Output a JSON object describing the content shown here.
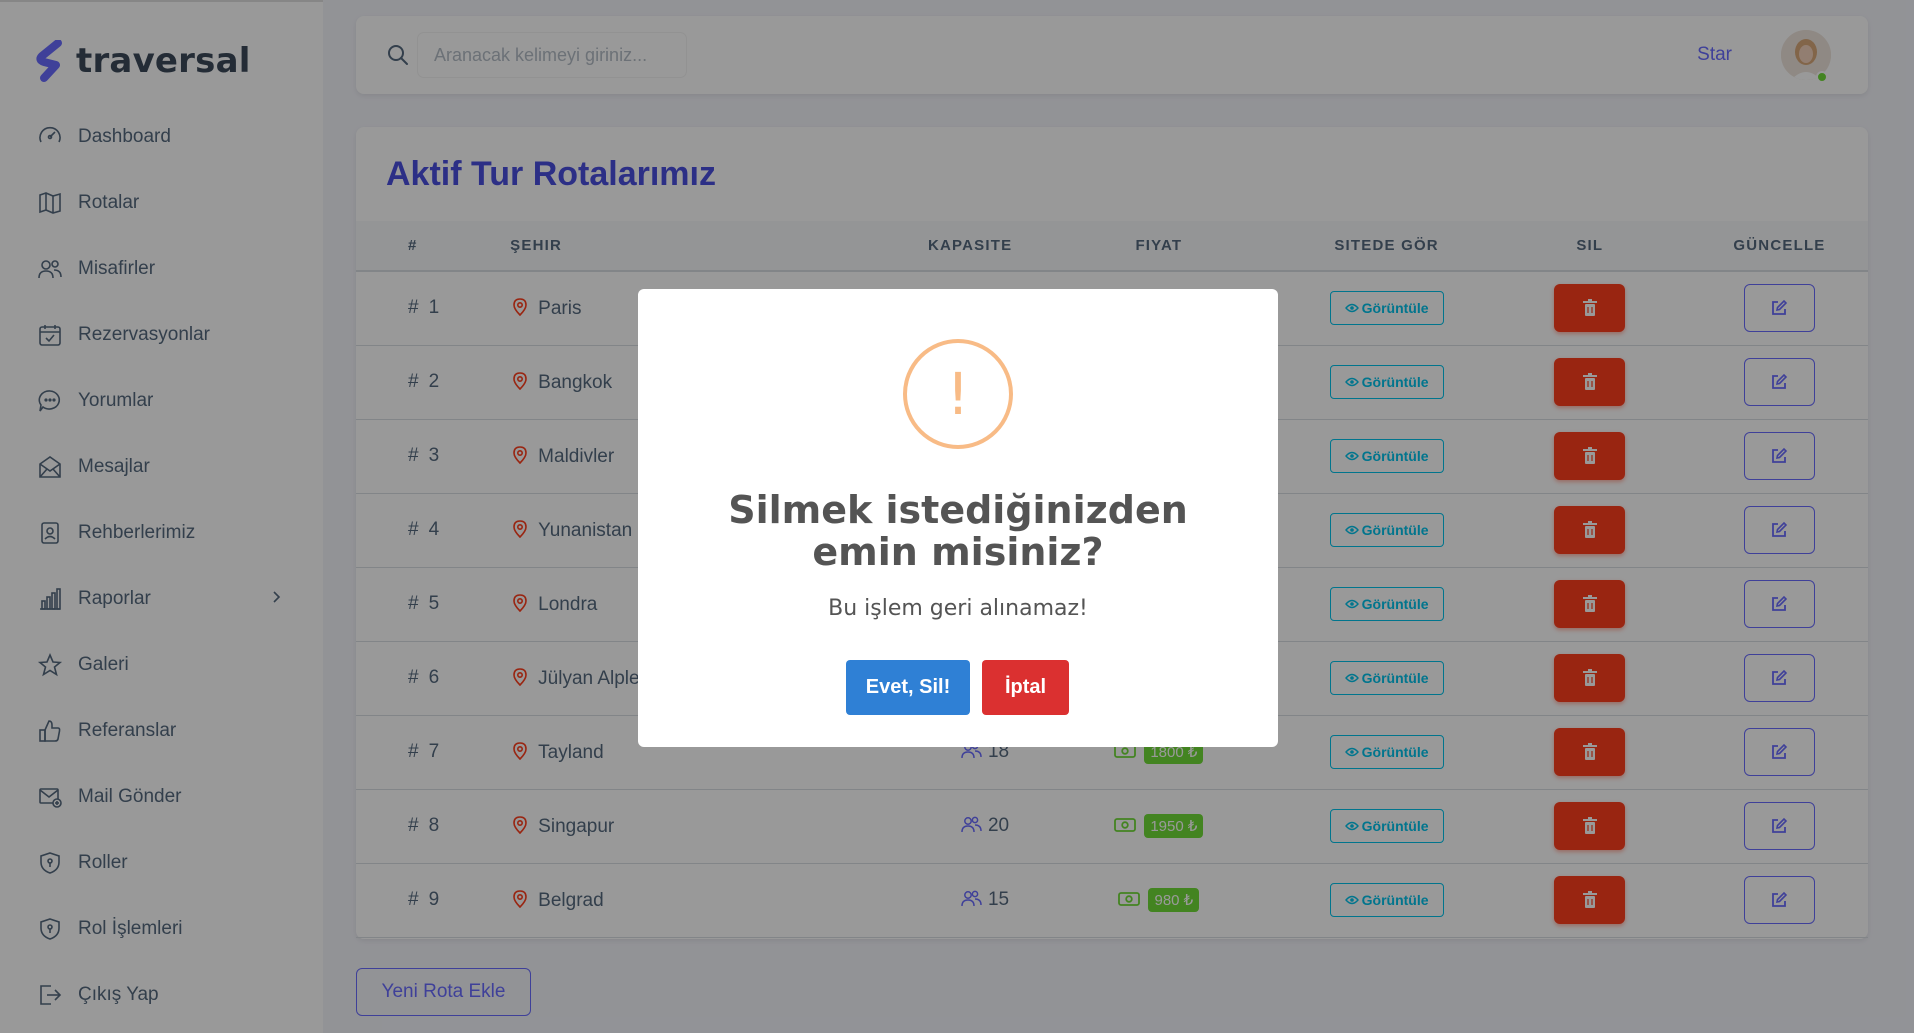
{
  "brand": {
    "name": "traversal"
  },
  "sidebar": {
    "items": [
      {
        "label": "Dashboard",
        "icon": "gauge-icon"
      },
      {
        "label": "Rotalar",
        "icon": "map-icon"
      },
      {
        "label": "Misafirler",
        "icon": "users-icon"
      },
      {
        "label": "Rezervasyonlar",
        "icon": "calendar-check-icon"
      },
      {
        "label": "Yorumlar",
        "icon": "chat-icon"
      },
      {
        "label": "Mesajlar",
        "icon": "envelope-open-icon"
      },
      {
        "label": "Rehberlerimiz",
        "icon": "id-badge-icon"
      },
      {
        "label": "Raporlar",
        "icon": "bar-chart-icon",
        "has_submenu": true
      },
      {
        "label": "Galeri",
        "icon": "star-icon"
      },
      {
        "label": "Referanslar",
        "icon": "thumbs-up-icon"
      },
      {
        "label": "Mail Gönder",
        "icon": "mail-plus-icon"
      },
      {
        "label": "Roller",
        "icon": "shield-icon"
      },
      {
        "label": "Rol İşlemleri",
        "icon": "shield-icon"
      },
      {
        "label": "Çıkış Yap",
        "icon": "logout-icon"
      }
    ]
  },
  "navbar": {
    "search_placeholder": "Aranacak kelimeyi giriniz...",
    "user_name": "Star"
  },
  "card": {
    "title": "Aktif Tur Rotalarımız",
    "columns": [
      "#",
      "ŞEHIR",
      "KAPASITE",
      "FIYAT",
      "SITEDE GÖR",
      "SIL",
      "GÜNCELLE"
    ],
    "view_label": "Görüntüle",
    "rows": [
      {
        "num": "1",
        "city": "Paris",
        "capacity": "",
        "price": ""
      },
      {
        "num": "2",
        "city": "Bangkok",
        "capacity": "",
        "price": ""
      },
      {
        "num": "3",
        "city": "Maldivler",
        "capacity": "",
        "price": ""
      },
      {
        "num": "4",
        "city": "Yunanistan",
        "capacity": "",
        "price": ""
      },
      {
        "num": "5",
        "city": "Londra",
        "capacity": "",
        "price": ""
      },
      {
        "num": "6",
        "city": "Jülyan Alpleri",
        "capacity": "",
        "price": ""
      },
      {
        "num": "7",
        "city": "Tayland",
        "capacity": "18",
        "price": "1800 ₺"
      },
      {
        "num": "8",
        "city": "Singapur",
        "capacity": "20",
        "price": "1950 ₺"
      },
      {
        "num": "9",
        "city": "Belgrad",
        "capacity": "15",
        "price": "980 ₺"
      }
    ],
    "add_button": "Yeni Rota Ekle"
  },
  "modal": {
    "icon_glyph": "!",
    "title": "Silmek istediğinizden emin misiniz?",
    "text": "Bu işlem geri alınamaz!",
    "confirm": "Evet, Sil!",
    "cancel": "İptal",
    "colors": {
      "warning": "#f8bb86",
      "confirm": "#2f80d5",
      "cancel": "#db3030"
    }
  },
  "colors": {
    "primary": "#696cff",
    "success": "#71dd37",
    "info": "#03c3ec",
    "danger": "#ff3e1d"
  }
}
